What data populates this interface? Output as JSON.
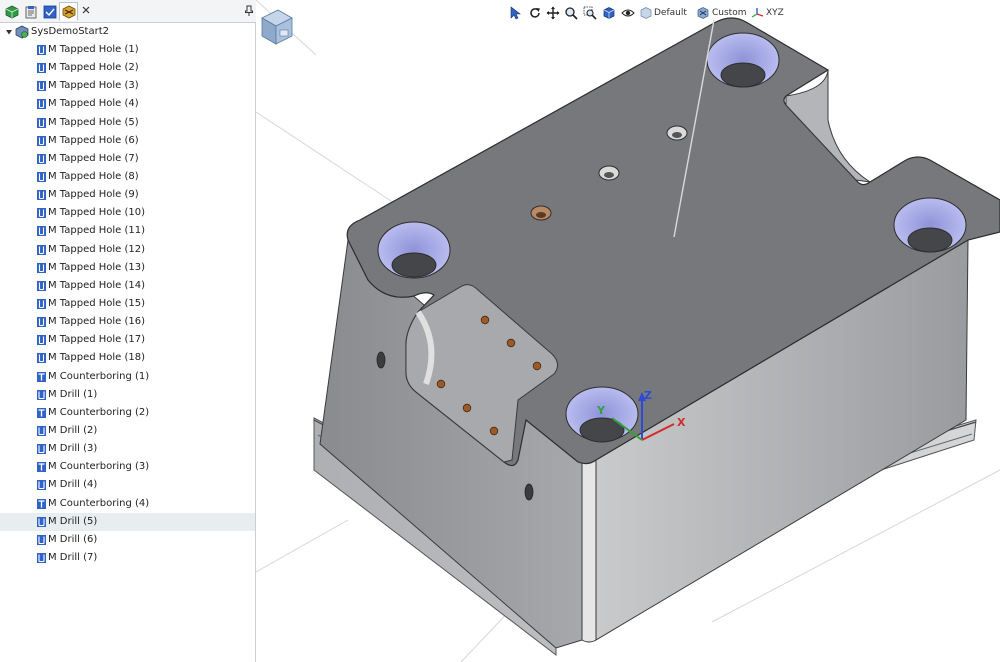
{
  "tree": {
    "root_label": "SysDemoStart2",
    "items": [
      {
        "label": "M Tapped Hole (1)",
        "kind": "tapped"
      },
      {
        "label": "M Tapped Hole (2)",
        "kind": "tapped"
      },
      {
        "label": "M Tapped Hole (3)",
        "kind": "tapped"
      },
      {
        "label": "M Tapped Hole (4)",
        "kind": "tapped"
      },
      {
        "label": "M Tapped Hole (5)",
        "kind": "tapped"
      },
      {
        "label": "M Tapped Hole (6)",
        "kind": "tapped"
      },
      {
        "label": "M Tapped Hole (7)",
        "kind": "tapped"
      },
      {
        "label": "M Tapped Hole (8)",
        "kind": "tapped"
      },
      {
        "label": "M Tapped Hole (9)",
        "kind": "tapped"
      },
      {
        "label": "M Tapped Hole (10)",
        "kind": "tapped"
      },
      {
        "label": "M Tapped Hole (11)",
        "kind": "tapped"
      },
      {
        "label": "M Tapped Hole (12)",
        "kind": "tapped"
      },
      {
        "label": "M Tapped Hole (13)",
        "kind": "tapped"
      },
      {
        "label": "M Tapped Hole (14)",
        "kind": "tapped"
      },
      {
        "label": "M Tapped Hole (15)",
        "kind": "tapped"
      },
      {
        "label": "M Tapped Hole (16)",
        "kind": "tapped"
      },
      {
        "label": "M Tapped Hole (17)",
        "kind": "tapped"
      },
      {
        "label": "M Tapped Hole (18)",
        "kind": "tapped"
      },
      {
        "label": "M Counterboring (1)",
        "kind": "counterbore"
      },
      {
        "label": "M Drill (1)",
        "kind": "drill"
      },
      {
        "label": "M Counterboring (2)",
        "kind": "counterbore"
      },
      {
        "label": "M Drill (2)",
        "kind": "drill"
      },
      {
        "label": "M Drill (3)",
        "kind": "drill"
      },
      {
        "label": "M Counterboring (3)",
        "kind": "counterbore"
      },
      {
        "label": "M Drill (4)",
        "kind": "drill"
      },
      {
        "label": "M Counterboring (4)",
        "kind": "counterbore"
      },
      {
        "label": "M Drill (5)",
        "kind": "drill",
        "selected": true
      },
      {
        "label": "M Drill (6)",
        "kind": "drill"
      },
      {
        "label": "M Drill (7)",
        "kind": "drill"
      }
    ]
  },
  "toolbar": {
    "view_default_label": "Default",
    "view_custom_label": "Custom",
    "view_xyz_label": "XYZ"
  },
  "triad": {
    "x_label": "X",
    "y_label": "Y",
    "z_label": "Z"
  },
  "colors": {
    "icon_blue": "#2f63c7",
    "selection_bg": "#e8eef0",
    "part_face": "#7b7c7f",
    "part_side": "#9b9ca0",
    "counterbore_wall": "#a4a9e8",
    "tapped_hole": "#9a5a2a",
    "axis_x": "#d12b2b",
    "axis_y": "#2ea43a",
    "axis_z": "#2f4bd6"
  }
}
